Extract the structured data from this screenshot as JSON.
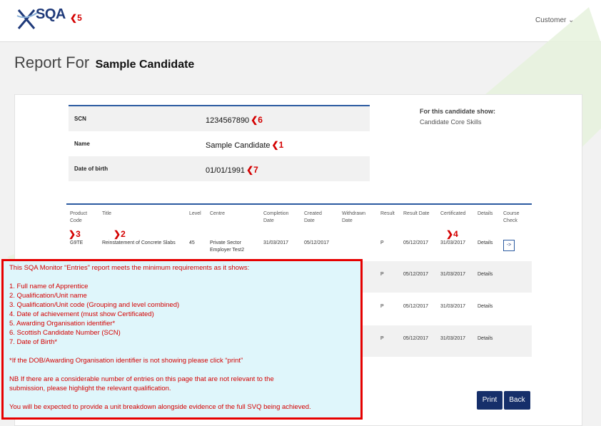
{
  "header": {
    "logo_text": "SQA",
    "logo_marker": "5",
    "customer_label": "Customer",
    "customer_chevron": "chevron-down-icon"
  },
  "page": {
    "title_prefix": "Report For",
    "candidate_name": "Sample Candidate"
  },
  "info": {
    "rows": [
      {
        "label": "SCN",
        "value": "1234567890",
        "marker": "6"
      },
      {
        "label": "Name",
        "value": "Sample Candidate",
        "marker": "1"
      },
      {
        "label": "Date of birth",
        "value": "01/01/1991",
        "marker": "7"
      }
    ]
  },
  "show_panel": {
    "title": "For this candidate show:",
    "item": "Candidate Core Skills"
  },
  "table": {
    "headers": [
      "Product Code",
      "Title",
      "Level",
      "Centre",
      "Completion Date",
      "Created Date",
      "Withdrawn Date",
      "Result",
      "Result Date",
      "Certificated",
      "Details",
      "Course Check"
    ],
    "markers": {
      "product_code": "3",
      "title": "2",
      "certificated": "4"
    },
    "rows": [
      {
        "product_code": "G9TE",
        "title": "Reinstatement of Concrete Slabs",
        "level": "45",
        "centre": "Private Sector Employer Test2",
        "completion": "31/03/2017",
        "created": "05/12/2017",
        "withdrawn": "",
        "result": "P",
        "result_date": "05/12/2017",
        "certificated": "31/03/2017",
        "details": "Details",
        "course_check": "->"
      },
      {
        "result": "P",
        "result_date": "05/12/2017",
        "certificated": "31/03/2017",
        "details": "Details"
      },
      {
        "result": "P",
        "result_date": "05/12/2017",
        "certificated": "31/03/2017",
        "details": "Details"
      },
      {
        "result": "P",
        "result_date": "05/12/2017",
        "certificated": "31/03/2017",
        "details": "Details"
      }
    ]
  },
  "buttons": {
    "print": "Print",
    "back": "Back"
  },
  "callout": {
    "lines": [
      "This SQA Monitor “Entries” report meets the minimum requirements as it shows:",
      "",
      "1. Full name of Apprentice",
      "2. Qualification/Unit name",
      "3. Qualification/Unit code (Grouping and level combined)",
      "4. Date of achievement (must show Certificated)",
      "5. Awarding Organisation identifier*",
      "6. Scottish Candidate Number (SCN)",
      "7. Date of Birth*",
      "",
      "*If the DOB/Awarding Organisation identifier is not showing please click “print”",
      "",
      "NB If there are a considerable number of entries on this page that are not relevant to the",
      "submission, please highlight the relevant qualification.",
      "",
      "You will be expected to provide a unit breakdown alongside evidence of the full SVQ being achieved."
    ]
  },
  "colors": {
    "accent": "#162f6a",
    "marker": "#d40000",
    "callout_bg": "#dff6fb"
  }
}
